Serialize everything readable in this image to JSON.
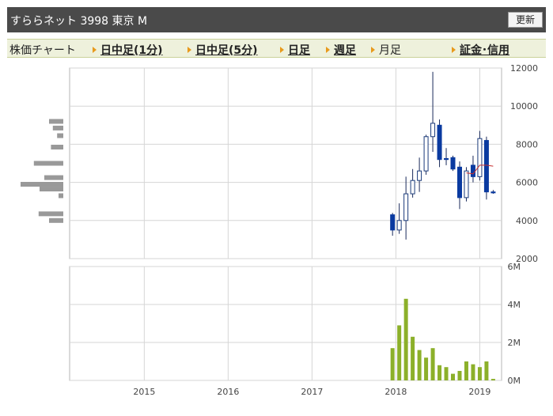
{
  "header": {
    "title": "すららネット  3998  東京 M",
    "refresh_label": "更新"
  },
  "nav": {
    "chart_label": "株価チャート",
    "links": [
      {
        "label": "日中足(1分)",
        "active": false
      },
      {
        "label": "日中足(5分)",
        "active": false
      },
      {
        "label": "日足",
        "active": false
      },
      {
        "label": "週足",
        "active": false
      },
      {
        "label": "月足",
        "active": true
      },
      {
        "label": "証金･信用",
        "active": false
      }
    ]
  },
  "chart_data": {
    "type": "candlestick",
    "x_ticks": [
      "2015",
      "2016",
      "2017",
      "2018",
      "2019"
    ],
    "x_range": [
      2014.11,
      2019.26
    ],
    "price_axis": {
      "min": 2000,
      "max": 12000,
      "ticks": [
        "2000",
        "4000",
        "6000",
        "8000",
        "10000",
        "12000"
      ]
    },
    "volume_axis": {
      "min": 0,
      "max": 6,
      "unit": "M",
      "ticks": [
        "0M",
        "2M",
        "4M",
        "6M"
      ]
    },
    "grid": true,
    "colors": {
      "up_fill": "#ffffff",
      "up_stroke": "#1a3a7a",
      "down_fill": "#0a3aa0",
      "volume": "#8cb02a",
      "ma": "#c83030",
      "profile": "#999999"
    },
    "candles": [
      {
        "t": 2017.96,
        "open": 4300,
        "high": 4400,
        "low": 3200,
        "close": 3500
      },
      {
        "t": 2018.04,
        "open": 3500,
        "high": 4900,
        "low": 3300,
        "close": 4000
      },
      {
        "t": 2018.12,
        "open": 4000,
        "high": 6300,
        "low": 3000,
        "close": 5400
      },
      {
        "t": 2018.2,
        "open": 5400,
        "high": 6700,
        "low": 5200,
        "close": 6100
      },
      {
        "t": 2018.28,
        "open": 6100,
        "high": 7300,
        "low": 5500,
        "close": 6600
      },
      {
        "t": 2018.36,
        "open": 6600,
        "high": 8500,
        "low": 6400,
        "close": 8400
      },
      {
        "t": 2018.44,
        "open": 8400,
        "high": 11800,
        "low": 7600,
        "close": 9100
      },
      {
        "t": 2018.52,
        "open": 9000,
        "high": 9300,
        "low": 6800,
        "close": 7200
      },
      {
        "t": 2018.6,
        "open": 7250,
        "high": 7800,
        "low": 6900,
        "close": 7200
      },
      {
        "t": 2018.68,
        "open": 7300,
        "high": 7400,
        "low": 6600,
        "close": 6700
      },
      {
        "t": 2018.76,
        "open": 6800,
        "high": 7100,
        "low": 4600,
        "close": 5200
      },
      {
        "t": 2018.84,
        "open": 5200,
        "high": 6800,
        "low": 5000,
        "close": 6600
      },
      {
        "t": 2018.92,
        "open": 6900,
        "high": 7400,
        "low": 6000,
        "close": 6300
      },
      {
        "t": 2019.0,
        "open": 6300,
        "high": 8700,
        "low": 6100,
        "close": 8300
      },
      {
        "t": 2019.08,
        "open": 8200,
        "high": 8400,
        "low": 5100,
        "close": 5500
      },
      {
        "t": 2019.16,
        "open": 5500,
        "high": 5600,
        "low": 5400,
        "close": 5450
      }
    ],
    "volume": [
      {
        "t": 2017.96,
        "v": 1.7
      },
      {
        "t": 2018.04,
        "v": 2.9
      },
      {
        "t": 2018.12,
        "v": 4.3
      },
      {
        "t": 2018.2,
        "v": 2.3
      },
      {
        "t": 2018.28,
        "v": 1.6
      },
      {
        "t": 2018.36,
        "v": 1.2
      },
      {
        "t": 2018.44,
        "v": 1.7
      },
      {
        "t": 2018.52,
        "v": 0.8
      },
      {
        "t": 2018.6,
        "v": 0.7
      },
      {
        "t": 2018.68,
        "v": 0.35
      },
      {
        "t": 2018.76,
        "v": 0.5
      },
      {
        "t": 2018.84,
        "v": 1.0
      },
      {
        "t": 2018.92,
        "v": 0.85
      },
      {
        "t": 2019.0,
        "v": 0.7
      },
      {
        "t": 2019.08,
        "v": 1.0
      },
      {
        "t": 2019.16,
        "v": 0.08
      }
    ],
    "moving_average": [
      {
        "t": 2018.84,
        "v": 6500
      },
      {
        "t": 2018.92,
        "v": 6450
      },
      {
        "t": 2019.0,
        "v": 6900
      },
      {
        "t": 2019.08,
        "v": 6900
      },
      {
        "t": 2019.16,
        "v": 6850
      }
    ],
    "price_volume_profile": [
      {
        "price": 9200,
        "vol": 0.3
      },
      {
        "price": 8850,
        "vol": 0.22
      },
      {
        "price": 8450,
        "vol": 0.13
      },
      {
        "price": 7850,
        "vol": 0.26
      },
      {
        "price": 7000,
        "vol": 0.62
      },
      {
        "price": 6250,
        "vol": 0.4
      },
      {
        "price": 5900,
        "vol": 0.9
      },
      {
        "price": 5650,
        "vol": 0.5
      },
      {
        "price": 5300,
        "vol": 0.1
      },
      {
        "price": 4350,
        "vol": 0.52
      },
      {
        "price": 4000,
        "vol": 0.3
      }
    ]
  }
}
